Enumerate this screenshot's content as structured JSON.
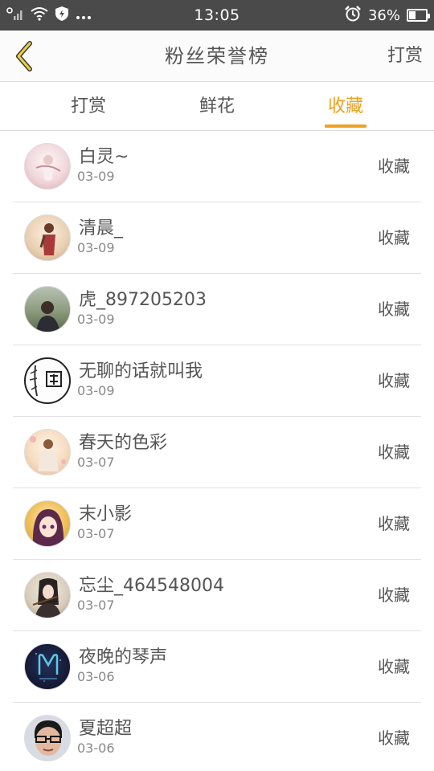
{
  "status_bar": {
    "time": "13:05",
    "battery_text": "36%",
    "battery_level": 0.36,
    "icons": [
      "signal-icon",
      "wifi-icon",
      "shield-icon",
      "more-icon",
      "alarm-icon",
      "battery-icon"
    ]
  },
  "header": {
    "title": "粉丝荣誉榜",
    "action_label": "打赏",
    "accent_color": "#f0a020"
  },
  "tabs": [
    {
      "label": "打赏",
      "active": false
    },
    {
      "label": "鲜花",
      "active": false
    },
    {
      "label": "收藏",
      "active": true
    }
  ],
  "list": {
    "action_label": "收藏",
    "items": [
      {
        "name": "白灵~",
        "date": "03-09"
      },
      {
        "name": "清晨_",
        "date": "03-09"
      },
      {
        "name": "虎_897205203",
        "date": "03-09"
      },
      {
        "name": "无聊的话就叫我",
        "date": "03-09"
      },
      {
        "name": "春天的色彩",
        "date": "03-07"
      },
      {
        "name": "末小影",
        "date": "03-07"
      },
      {
        "name": "忘尘_464548004",
        "date": "03-07"
      },
      {
        "name": "夜晚的琴声",
        "date": "03-06"
      },
      {
        "name": "夏超超",
        "date": "03-06"
      }
    ]
  }
}
